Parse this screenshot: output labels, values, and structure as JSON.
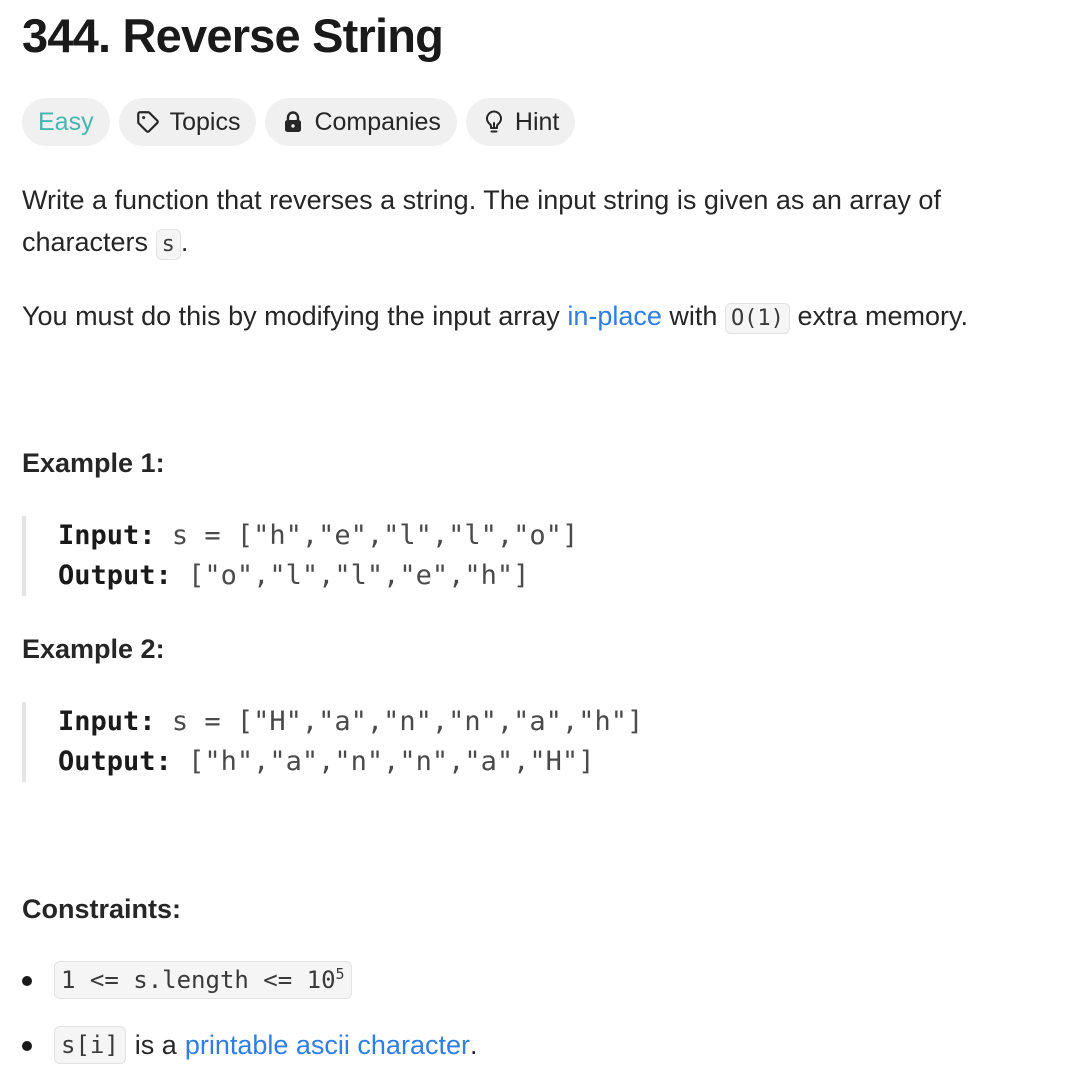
{
  "problem": {
    "title": "344. Reverse String",
    "tags": {
      "difficulty": "Easy",
      "topics": "Topics",
      "companies": "Companies",
      "hint": "Hint"
    },
    "description": {
      "line1": "Write a function that reverses a string. The input string is given as an array of",
      "line2_text": "characters",
      "line2_code": "s",
      "line2_end": ".",
      "para2_start": "You must do this by modifying the input array",
      "para2_link": "in-place",
      "para2_mid": "with",
      "para2_code": "O(1)",
      "para2_end": "extra memory."
    },
    "examples": [
      {
        "heading": "Example 1:",
        "input_label": "Input:",
        "input_value": "s = [\"h\",\"e\",\"l\",\"l\",\"o\"]",
        "output_label": "Output:",
        "output_value": "[\"o\",\"l\",\"l\",\"e\",\"h\"]"
      },
      {
        "heading": "Example 2:",
        "input_label": "Input:",
        "input_value": "s = [\"H\",\"a\",\"n\",\"n\",\"a\",\"h\"]",
        "output_label": "Output:",
        "output_value": "[\"h\",\"a\",\"n\",\"n\",\"a\",\"H\"]"
      }
    ],
    "constraints": {
      "heading": "Constraints:",
      "item1_code": "1 <= s.length <= 10",
      "item1_sup": "5",
      "item2_code": "s[i]",
      "item2_text": "is a",
      "item2_link": "printable ascii character",
      "item2_end": "."
    }
  },
  "colors": {
    "easy": "#46b5b0",
    "link": "#2f7ee6",
    "chip_bg": "#f0f0f0"
  },
  "icons": {
    "topics": "tag-icon",
    "companies": "lock-icon",
    "hint": "lightbulb-icon"
  }
}
